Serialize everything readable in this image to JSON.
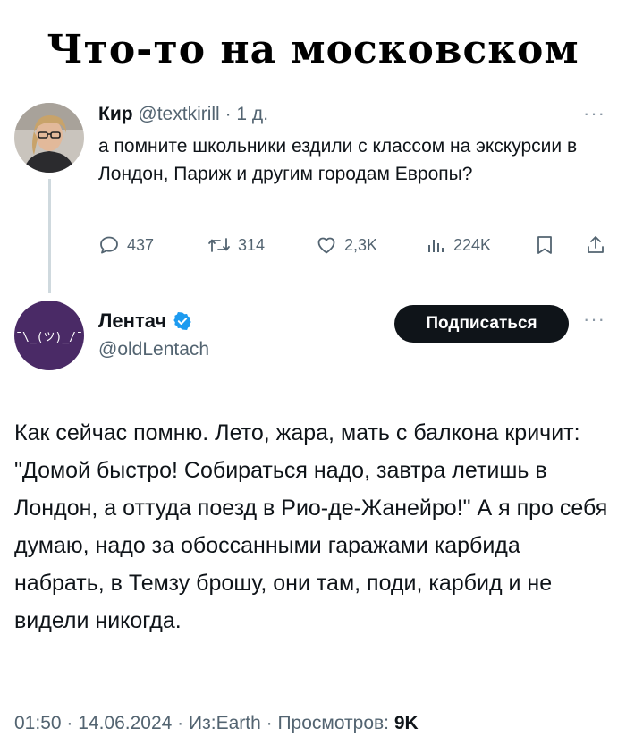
{
  "meme_title": "Что-то на московском",
  "tweet1": {
    "name": "Кир",
    "handle": "@textkirill",
    "separator": "·",
    "time": "1 д.",
    "text": "а помните школьники ездили с классом на экскурсии в Лондон, Париж и другим городам Европы?",
    "actions": {
      "replies": "437",
      "retweets": "314",
      "likes": "2,3K",
      "views": "224K"
    }
  },
  "tweet2": {
    "name": "Лентач",
    "handle": "@oldLentach",
    "avatar_text": "¯\\_(ツ)_/¯",
    "follow_label": "Подписаться",
    "text": "Как сейчас помню. Лето, жара, мать с балкона кричит: \"Домой быстро! Собираться надо, завтра летишь в Лондон, а оттуда поезд в Рио-де-Жанейро!\" А я про себя думаю, надо за обоссанными гаражами карбида набрать, в Темзу брошу, они там, поди, карбид и не видели никогда.",
    "meta": {
      "time": "01:50",
      "sep": " · ",
      "date": "14.06.2024",
      "source": "Из:Earth",
      "views_label": "Просмотров:",
      "views_count": "9K"
    }
  },
  "colors": {
    "text": "#0f1419",
    "muted": "#536471",
    "verified": "#1d9bf0",
    "avatar_bg": "#4a2a66",
    "button_bg": "#0f1419"
  },
  "icons": [
    "reply-icon",
    "retweet-icon",
    "like-icon",
    "views-icon",
    "bookmark-icon",
    "share-icon",
    "more-icon",
    "verified-badge-icon"
  ]
}
